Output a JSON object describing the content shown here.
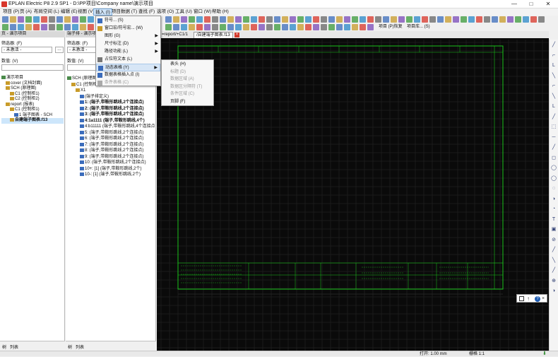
{
  "window": {
    "title": "EPLAN Electric P8 2.9 SP1 - D:\\PP项目\\Company name\\演示项目",
    "minimize": "—",
    "maximize": "□",
    "close": "✕"
  },
  "menubar": {
    "items": [
      "项目 (P)",
      "页 (A)",
      "布局空间 (L)",
      "编辑 (E)",
      "视图 (V)",
      "插入 (I)",
      "项目数据 (T)",
      "查找 (F)",
      "选项 (O)",
      "工具 (U)",
      "窗口 (W)",
      "帮助 (H)"
    ],
    "active_index": 5
  },
  "insert_menu": {
    "items": [
      {
        "label": "符号... (S)",
        "arrow": false,
        "disabled": false
      },
      {
        "label": "窗口宏/符号宏... (W)",
        "arrow": false,
        "disabled": false
      },
      {
        "label": "图形 (G)",
        "arrow": true,
        "disabled": false
      },
      {
        "label": "尺寸标注 (D)",
        "arrow": true,
        "disabled": false
      },
      {
        "label": "路径功能 (L)",
        "arrow": true,
        "disabled": false
      },
      {
        "label": "占位符文本 (L)",
        "arrow": false,
        "disabled": false
      },
      {
        "label": "动态表格 (Y)",
        "arrow": true,
        "disabled": false
      },
      {
        "label": "数据表格插入点 (I)",
        "arrow": false,
        "disabled": false
      },
      {
        "label": "条件表格 (C)",
        "arrow": false,
        "disabled": true
      }
    ],
    "highlight_index": 6
  },
  "dynamic_table_submenu": {
    "items": [
      {
        "label": "表头 (H)",
        "disabled": false
      },
      {
        "label": "标题 (D)",
        "disabled": true
      },
      {
        "label": "数据区域 (A)",
        "disabled": true
      },
      {
        "label": "数据区分隔符 (T)",
        "disabled": true
      },
      {
        "label": "条件区域 (C)",
        "disabled": true
      },
      {
        "label": "页脚 (F)",
        "disabled": false
      }
    ]
  },
  "toolbar": {
    "project_restore_label": "项目 (P)恢复",
    "project_restore_extra": "项目库... (S)"
  },
  "left_panel": {
    "header": "页 - 演示项目",
    "filter_label": "筛选器: (F)",
    "filter_value": "- 未激活 -",
    "value_label": "数值: (V)",
    "tree": [
      {
        "label": "演示项目",
        "indent": 0,
        "bold": false
      },
      {
        "label": "cover (文档封面)",
        "indent": 1,
        "bold": false
      },
      {
        "label": "SCH (原理图)",
        "indent": 1,
        "bold": false
      },
      {
        "label": "C1 (控制柜1)",
        "indent": 2,
        "bold": false
      },
      {
        "label": "C2 (控制柜2)",
        "indent": 2,
        "bold": false
      },
      {
        "label": "report (报表)",
        "indent": 1,
        "bold": false
      },
      {
        "label": "C1 (控制柜1)",
        "indent": 2,
        "bold": false
      },
      {
        "label": "1 端子图表 - SCH",
        "indent": 3,
        "bold": false
      },
      {
        "label": "自建端子图表.f13",
        "indent": 2,
        "bold": true,
        "selected": true
      }
    ],
    "footer_left": "树",
    "footer_right": "列表"
  },
  "mid_panel": {
    "header": "端子排 - 演示项目",
    "filter_label": "筛选器: (F)",
    "filter_value": "- 未激活 -",
    "value_label": "数值: (V)",
    "tree": [
      {
        "label": "SCH (原理图)",
        "indent": 0,
        "bold": false
      },
      {
        "label": "C1 (控制柜1)",
        "indent": 1,
        "bold": false
      },
      {
        "label": "X1",
        "indent": 2,
        "bold": false
      },
      {
        "label": "(端子排定义)",
        "indent": 3,
        "bold": false
      },
      {
        "label": "1: (端子,带鞍形跳线,2个连接点)",
        "indent": 3,
        "bold": true
      },
      {
        "label": "2: (端子,带鞍形跳线,2个连接点)",
        "indent": 3,
        "bold": true
      },
      {
        "label": "3: (端子,带鞍形跳线,2个连接点)",
        "indent": 3,
        "bold": true
      },
      {
        "label": "4:1a1111 (端子,带鞍形跳线,4个)",
        "indent": 3,
        "bold": true
      },
      {
        "label": "4:b11111 (端子,带鞍形跳线,4个连接点)",
        "indent": 3,
        "bold": false
      },
      {
        "label": "5: (端子,带鞍形跳线,2个连接点)",
        "indent": 3,
        "bold": false
      },
      {
        "label": "6: (端子,带鞍形跳线,2个连接点)",
        "indent": 3,
        "bold": false
      },
      {
        "label": "7: (端子,带鞍形跳线,2个连接点)",
        "indent": 3,
        "bold": false
      },
      {
        "label": "8: (端子,带鞍形跳线,2个连接点)",
        "indent": 3,
        "bold": false
      },
      {
        "label": "9: (端子,带鞍形跳线,2个连接点)",
        "indent": 3,
        "bold": false
      },
      {
        "label": "10: (端子,带鞍形跳线,2个连接点)",
        "indent": 3,
        "bold": false
      },
      {
        "label": "10+: [1] (端子,带鞍形跳线,2个)",
        "indent": 3,
        "bold": false
      },
      {
        "label": "10-: [1] (端子,带鞍形跳线,2个)",
        "indent": 3,
        "bold": false
      }
    ],
    "footer_left": "树",
    "footer_right": "列表"
  },
  "doc_tabs": [
    {
      "label": "=report/+C1/1",
      "active": false
    },
    {
      "label": "/自建端子图表.f13",
      "active": true
    }
  ],
  "statusbar": {
    "coords": "打开: 1.00 mm",
    "grid": "栅格 1:1"
  },
  "colors": {
    "canvas": "#0a0a0a",
    "drawing_line": "#19c319",
    "accent": "#3b6cbb",
    "tab_close": "#d33a2c"
  }
}
